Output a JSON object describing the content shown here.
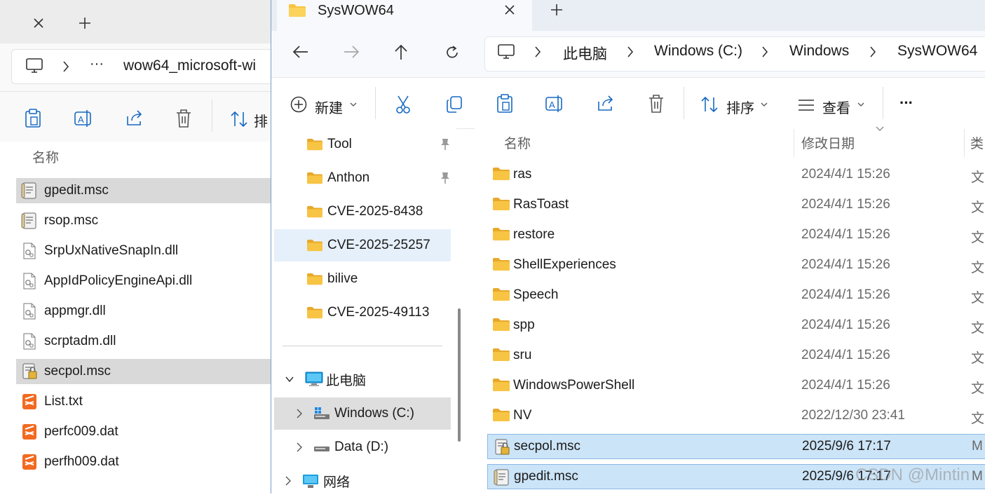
{
  "back_window": {
    "address_overflow": "···",
    "address_path": "wow64_microsoft-wi",
    "sort_label_partial": "排",
    "column_name": "名称",
    "files": [
      {
        "name": "gpedit.msc",
        "icon": "msc-icon",
        "selected": true
      },
      {
        "name": "rsop.msc",
        "icon": "msc-icon",
        "selected": false
      },
      {
        "name": "SrpUxNativeSnapIn.dll",
        "icon": "dll-icon",
        "selected": false
      },
      {
        "name": "AppIdPolicyEngineApi.dll",
        "icon": "dll-icon",
        "selected": false
      },
      {
        "name": "appmgr.dll",
        "icon": "dll-icon",
        "selected": false
      },
      {
        "name": "scrptadm.dll",
        "icon": "dll-icon",
        "selected": false
      },
      {
        "name": "secpol.msc",
        "icon": "secpol-icon",
        "selected": true
      },
      {
        "name": "List.txt",
        "icon": "sublime-icon",
        "selected": false
      },
      {
        "name": "perfc009.dat",
        "icon": "sublime-icon",
        "selected": false
      },
      {
        "name": "perfh009.dat",
        "icon": "sublime-icon",
        "selected": false
      }
    ]
  },
  "front_window": {
    "tab_title": "SysWOW64",
    "breadcrumb": [
      "此电脑",
      "Windows (C:)",
      "Windows",
      "SysWOW64"
    ],
    "toolbar": {
      "new_label": "新建",
      "sort_label": "排序",
      "view_label": "查看",
      "more_label": "···"
    },
    "nav": {
      "quick_access": [
        {
          "name": "Tool",
          "pinned": true
        },
        {
          "name": "Anthon",
          "pinned": true
        },
        {
          "name": "CVE-2025-8438",
          "pinned": false
        },
        {
          "name": "CVE-2025-25257",
          "pinned": false
        },
        {
          "name": "bilive",
          "pinned": false
        },
        {
          "name": "CVE-2025-49113",
          "pinned": false
        }
      ],
      "this_pc": "此电脑",
      "drive_c": "Windows (C:)",
      "drive_d": "Data (D:)",
      "network": "网络"
    },
    "columns": {
      "name": "名称",
      "modified": "修改日期",
      "type": "类"
    },
    "rows": [
      {
        "name": "ras",
        "modified": "2024/4/1 15:26",
        "type": "文",
        "icon": "folder-icon",
        "selected": false
      },
      {
        "name": "RasToast",
        "modified": "2024/4/1 15:26",
        "type": "文",
        "icon": "folder-icon",
        "selected": false
      },
      {
        "name": "restore",
        "modified": "2024/4/1 15:26",
        "type": "文",
        "icon": "folder-icon",
        "selected": false
      },
      {
        "name": "ShellExperiences",
        "modified": "2024/4/1 15:26",
        "type": "文",
        "icon": "folder-icon",
        "selected": false
      },
      {
        "name": "Speech",
        "modified": "2024/4/1 15:26",
        "type": "文",
        "icon": "folder-icon",
        "selected": false
      },
      {
        "name": "spp",
        "modified": "2024/4/1 15:26",
        "type": "文",
        "icon": "folder-icon",
        "selected": false
      },
      {
        "name": "sru",
        "modified": "2024/4/1 15:26",
        "type": "文",
        "icon": "folder-icon",
        "selected": false
      },
      {
        "name": "WindowsPowerShell",
        "modified": "2024/4/1 15:26",
        "type": "文",
        "icon": "folder-icon",
        "selected": false
      },
      {
        "name": "NV",
        "modified": "2022/12/30 23:41",
        "type": "文",
        "icon": "folder-icon",
        "selected": false
      },
      {
        "name": "secpol.msc",
        "modified": "2025/9/6 17:17",
        "type": "M",
        "icon": "secpol-icon",
        "selected": true
      },
      {
        "name": "gpedit.msc",
        "modified": "2025/9/6 17:17",
        "type": "M",
        "icon": "msc-icon",
        "selected": true
      }
    ]
  },
  "watermark": "CSDN @Mintin",
  "colors": {
    "accent": "#0067c0",
    "selection": "#cce4f7",
    "folder": "#f8c444"
  }
}
